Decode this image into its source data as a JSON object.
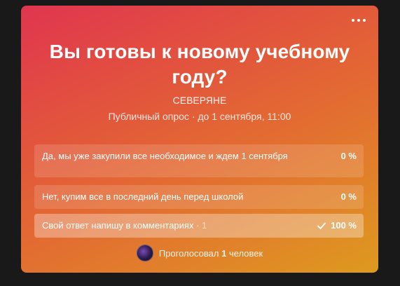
{
  "poll": {
    "title": "Вы готовы к новому учебному году?",
    "author": "СЕВЕРЯНЕ",
    "meta": "Публичный опрос · до 1 сентября, 11:00",
    "answers": [
      {
        "label": "Да, мы уже закупили все необходимое и ждем 1 сентября",
        "count": "",
        "percent": "0 %",
        "fraction": 0,
        "selected": false
      },
      {
        "label": "Нет, купим все в последний день перед школой",
        "count": "",
        "percent": "0 %",
        "fraction": 0,
        "selected": false
      },
      {
        "label": "Свой ответ напишу в комментариях",
        "count": " · 1",
        "percent": "100 %",
        "fraction": 1,
        "selected": true
      }
    ],
    "voters_prefix": "Проголосовал",
    "voters_count": "1",
    "voters_suffix": "человек"
  },
  "icons": {
    "more": "more-horizontal-icon",
    "check": "check-icon"
  },
  "colors": {
    "gradient_start": "#e0354f",
    "gradient_end": "#de9a1e",
    "text": "#ffffff"
  }
}
